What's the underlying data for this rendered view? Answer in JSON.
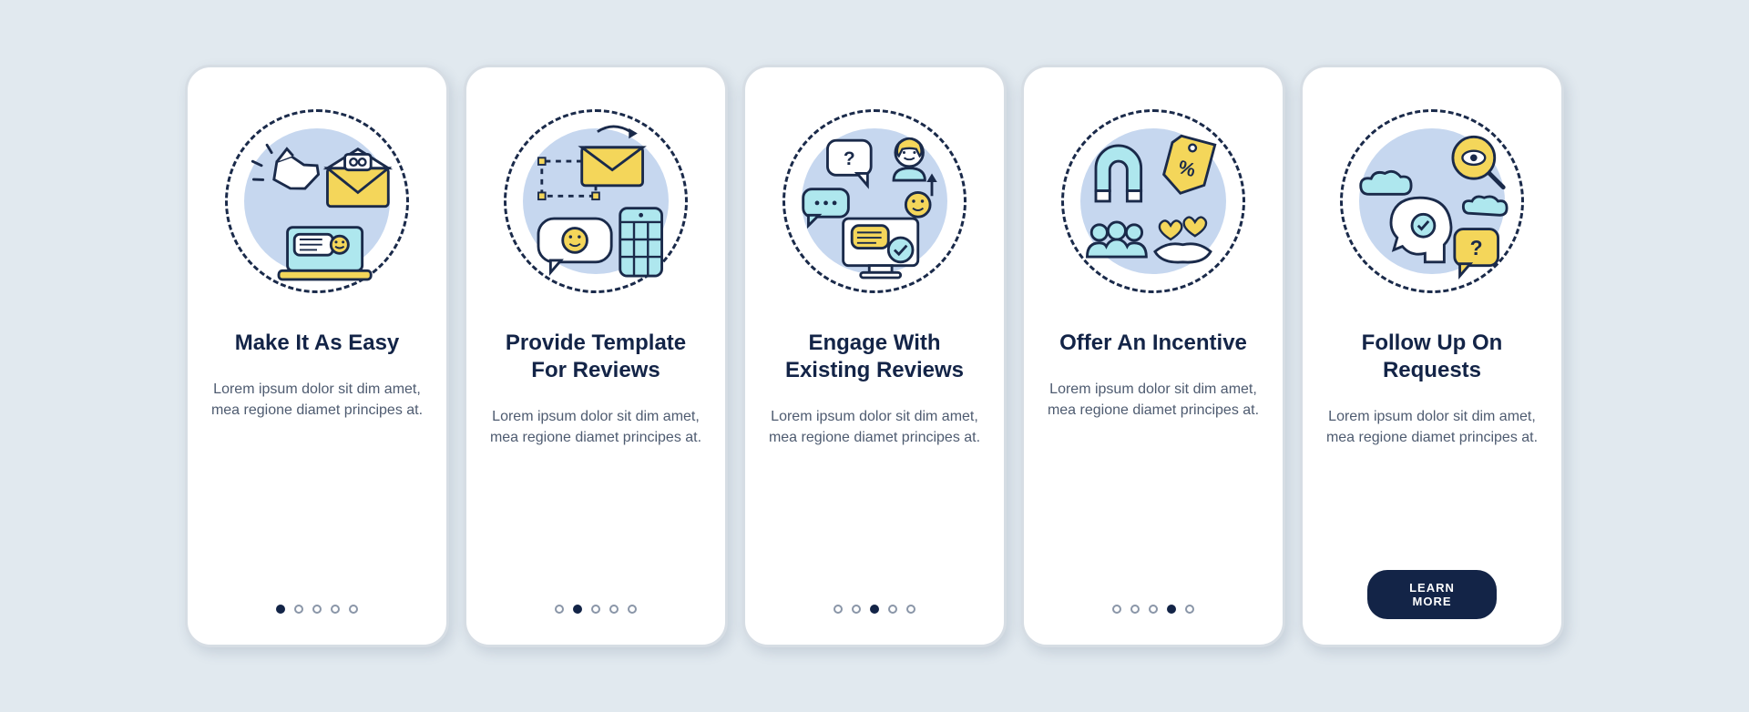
{
  "colors": {
    "bg": "#e1e9ef",
    "cardBg": "#ffffff",
    "cardBorder": "#d6dde4",
    "titleColor": "#132447",
    "descColor": "#4e5b70",
    "iconNavy": "#1a2a4a",
    "iconYellow": "#f4d65a",
    "iconCyan": "#aee7ee",
    "discBlue": "#c6d7ef"
  },
  "screenCount": 5,
  "screens": [
    {
      "id": "easy",
      "title": "Make It As Easy",
      "desc": "Lorem ipsum dolor sit dim amet, mea regione diamet principes at.",
      "iconName": "tap-email-laptop-icon",
      "activeIndex": 0,
      "hasButton": false
    },
    {
      "id": "template",
      "title": "Provide Template For Reviews",
      "desc": "Lorem ipsum dolor sit dim amet, mea regione diamet principes at.",
      "iconName": "envelope-smiley-phone-icon",
      "activeIndex": 1,
      "hasButton": false
    },
    {
      "id": "engage",
      "title": "Engage With Existing Reviews",
      "desc": "Lorem ipsum dolor sit dim amet, mea regione diamet principes at.",
      "iconName": "chat-person-monitor-icon",
      "activeIndex": 2,
      "hasButton": false
    },
    {
      "id": "incentive",
      "title": "Offer An Incentive",
      "desc": "Lorem ipsum dolor sit dim amet, mea regione diamet principes at.",
      "iconName": "magnet-discount-people-icon",
      "activeIndex": 3,
      "hasButton": false
    },
    {
      "id": "followup",
      "title": "Follow Up On Requests",
      "desc": "Lorem ipsum dolor sit dim amet, mea regione diamet principes at.",
      "iconName": "head-search-question-icon",
      "activeIndex": 4,
      "hasButton": true,
      "buttonLabel": "LEARN MORE"
    }
  ]
}
